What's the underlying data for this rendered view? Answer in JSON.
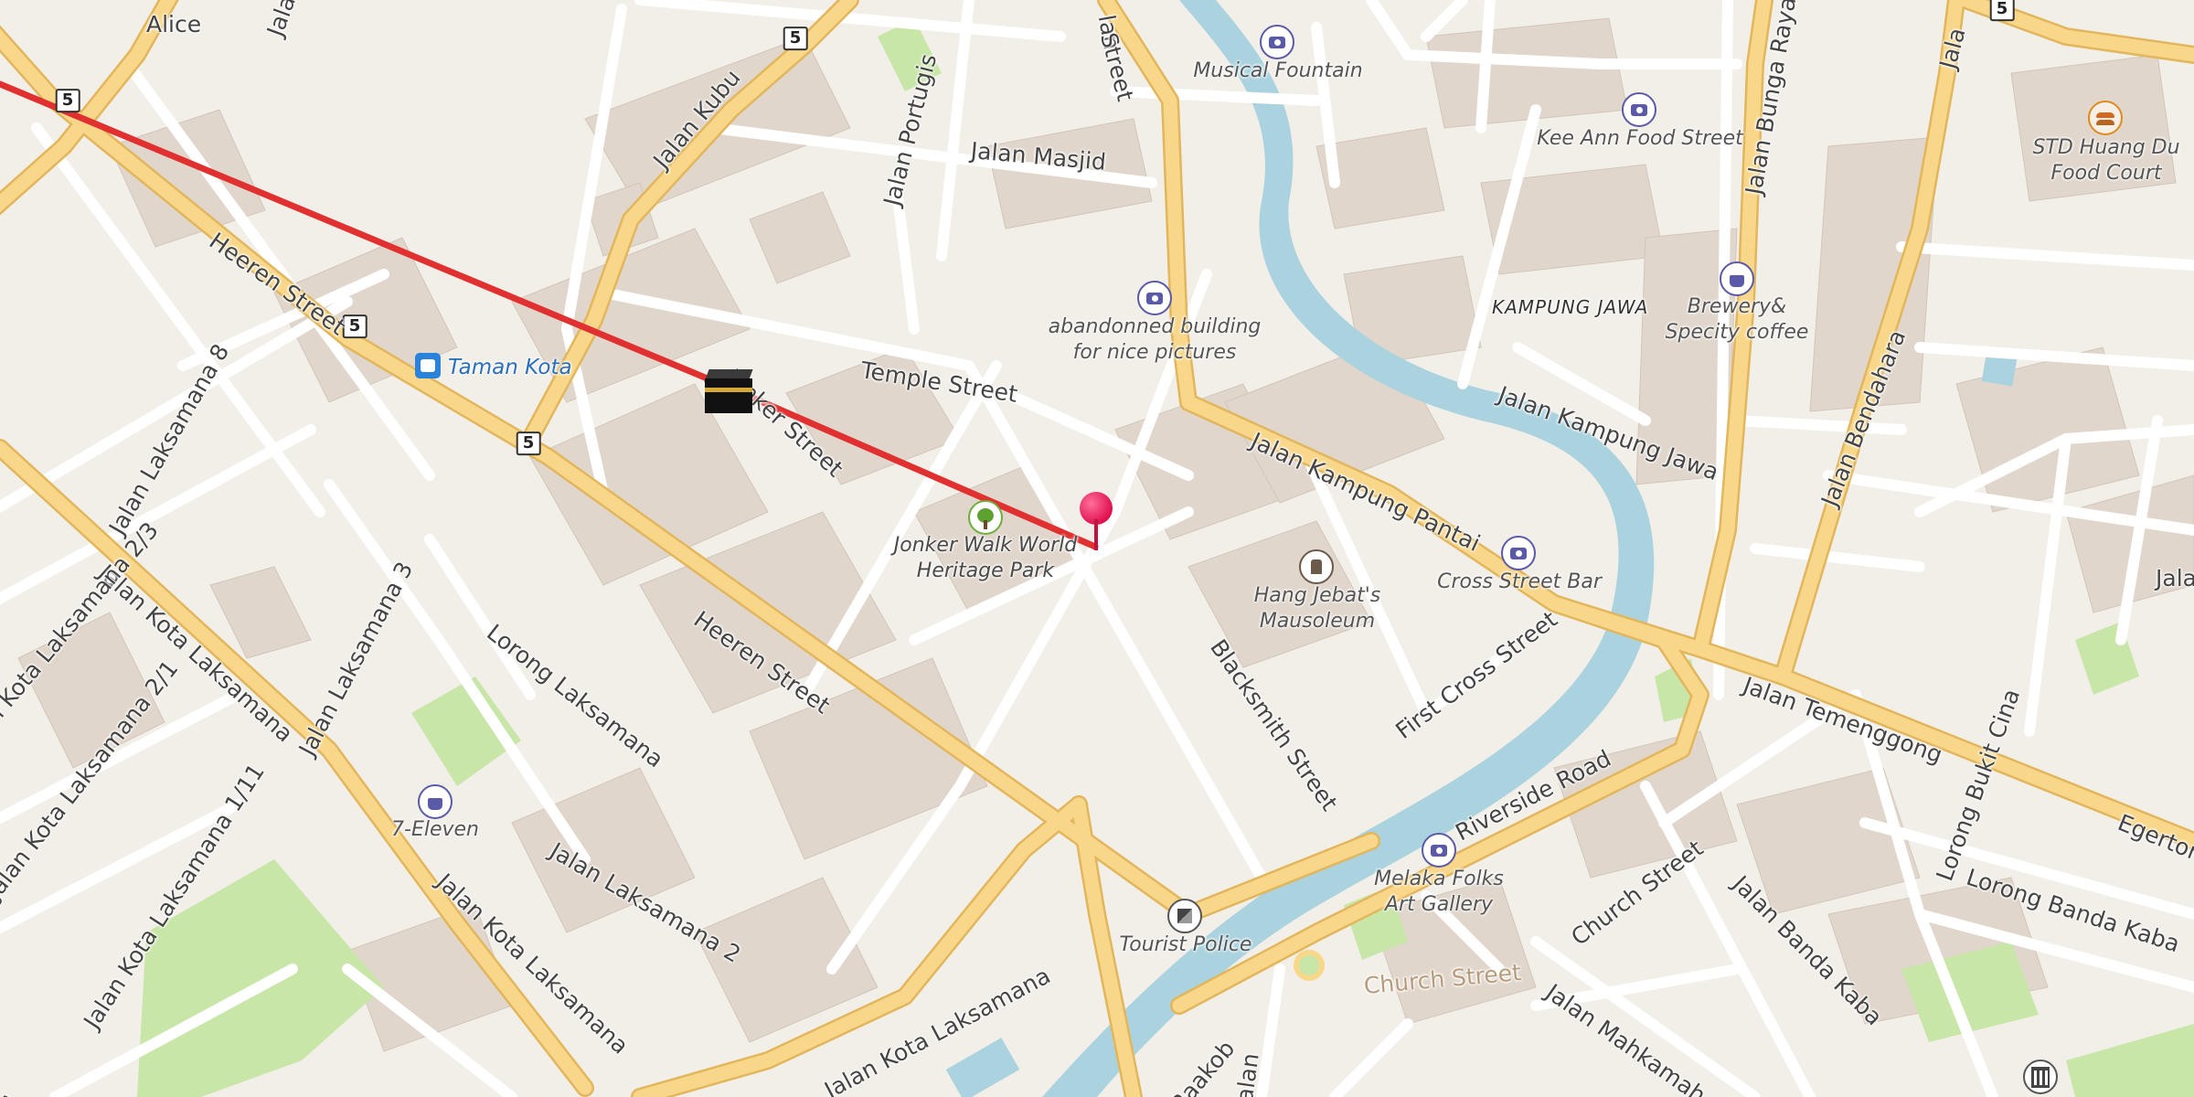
{
  "map": {
    "colors": {
      "background": "#f2efe9",
      "building": "#e0d6cc",
      "major_road": "#f9d78a",
      "major_road_casing": "#e2b65c",
      "minor_road": "#ffffff",
      "river": "#aad3df",
      "park": "#c8e6a8",
      "route": "#e03030"
    },
    "road_labels": [
      {
        "text": "Jalan Kubu",
        "icon": ""
      },
      {
        "text": "Jalan Portugis"
      },
      {
        "text": "Jalan Masjid"
      },
      {
        "text": "Heeren Street"
      },
      {
        "text": "Heeren Street"
      },
      {
        "text": "Jonker Street"
      },
      {
        "text": "Temple Street"
      },
      {
        "text": "Jalan Kampung Pantai"
      },
      {
        "text": "Jalan Kampung Jawa"
      },
      {
        "text": "Jalan Bunga Raya"
      },
      {
        "text": "Jalan Bendahara"
      },
      {
        "text": "Jalan Laksamana 8"
      },
      {
        "text": "Jalan Laksamana 3"
      },
      {
        "text": "Lorong Laksamana"
      },
      {
        "text": "Jalan Laksamana 2"
      },
      {
        "text": "Jalan Kota Laksamana"
      },
      {
        "text": "Jalan Kota Laksamana"
      },
      {
        "text": "Jalan Kota Laksamana"
      },
      {
        "text": "Jalan Kota Laksamana 2/3"
      },
      {
        "text": "Jalan Kota Laksamana 2/1"
      },
      {
        "text": "Jalan Kota Laksamana 1/11"
      },
      {
        "text": "Blacksmith Street"
      },
      {
        "text": "First Cross Street"
      },
      {
        "text": "Riverside Road"
      },
      {
        "text": "Church Street"
      },
      {
        "text": "Church Street"
      },
      {
        "text": "Jalan Banda Kaba"
      },
      {
        "text": "Jalan Mahkamah"
      },
      {
        "text": "Jalan Temenggong"
      },
      {
        "text": "Lorong Bukit Cina"
      },
      {
        "text": "Lorong Banda Kaba"
      },
      {
        "text": "Egerton"
      },
      {
        "text": "Jala"
      },
      {
        "text": "Jalan"
      },
      {
        "text": "Jala"
      },
      {
        "text": "Jala"
      },
      {
        "text": "lan"
      },
      {
        "text": "Street"
      },
      {
        "text": "Alice"
      },
      {
        "text": "asm"
      },
      {
        "text": "Raakob"
      }
    ],
    "area_labels": [
      {
        "text": "KAMPUNG JAWA"
      }
    ],
    "shields": [
      {
        "text": "5"
      },
      {
        "text": "5"
      },
      {
        "text": "5"
      },
      {
        "text": "5"
      },
      {
        "text": "5"
      }
    ],
    "pois": [
      {
        "icon": "camera-icon",
        "label": "Musical Fountain"
      },
      {
        "icon": "camera-icon",
        "label": "Kee Ann Food Street"
      },
      {
        "icon": "fast-food-icon",
        "label_lines": [
          "STD Huang Du",
          "Food Court"
        ]
      },
      {
        "icon": "camera-icon",
        "label_lines": [
          "abandonned building",
          "for nice pictures"
        ]
      },
      {
        "icon": "shop-icon",
        "label_lines": [
          "Brewery&",
          "Specity coffee"
        ]
      },
      {
        "icon": "bus-stop-icon",
        "label": "Taman Kota"
      },
      {
        "icon": "tree-icon",
        "label_lines": [
          "Jonker Walk World",
          "Heritage Park"
        ]
      },
      {
        "icon": "monument-icon",
        "label_lines": [
          "Hang Jebat's",
          "Mausoleum"
        ]
      },
      {
        "icon": "camera-icon",
        "label": "Cross Street Bar"
      },
      {
        "icon": "shop-icon",
        "label": "7-Eleven"
      },
      {
        "icon": "camera-icon",
        "label_lines": [
          "Melaka Folks",
          "Art Gallery"
        ]
      },
      {
        "icon": "police-icon",
        "label": "Tourist Police"
      },
      {
        "icon": "kaaba-icon"
      },
      {
        "icon": "museum-icon"
      }
    ],
    "marker": {
      "icon": "location-pin-icon"
    }
  }
}
